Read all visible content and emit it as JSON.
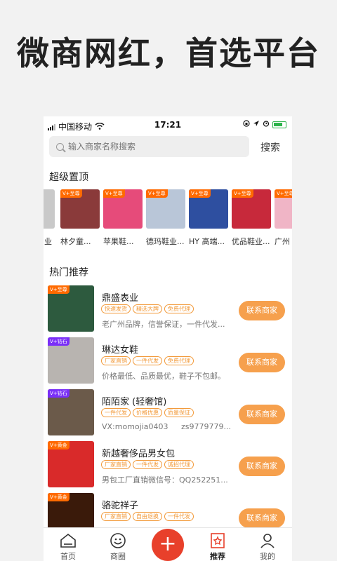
{
  "hero": {
    "title": "微商网红，首选平台"
  },
  "status_bar": {
    "carrier": "中国移动",
    "time": "17:21"
  },
  "search": {
    "placeholder": "输入商家名称搜索",
    "button": "搜索"
  },
  "sections": {
    "top": "超级置顶",
    "hot": "热门推荐"
  },
  "top_stores": [
    {
      "name": "业",
      "color": "#c9c9c9"
    },
    {
      "name": "林夕童...",
      "color": "#8a3a3a",
      "badge": "V+至尊"
    },
    {
      "name": "苹果鞋...",
      "color": "#e64b7a",
      "badge": "V+至尊"
    },
    {
      "name": "德玛鞋业...",
      "color": "#b9c6d8",
      "badge": "V+至尊"
    },
    {
      "name": "HY 高端...",
      "color": "#2e4fa0",
      "badge": "V+至尊"
    },
    {
      "name": "优品鞋业...",
      "color": "#c7293b",
      "badge": "V+至尊"
    },
    {
      "name": "广州",
      "color": "#f0b5c6",
      "badge": "V+至尊"
    }
  ],
  "hot_items": [
    {
      "title": "鼎盛表业",
      "tags": [
        "快速发货",
        "精选大牌",
        "免费代理"
      ],
      "desc": "老广州品牌，信誉保证，一件代发...",
      "desc2": "",
      "badge": "V+至尊",
      "color": "#2d5a3e",
      "button": "联系商家"
    },
    {
      "title": "琳达女鞋",
      "tags": [
        "厂家直销",
        "一件代发",
        "免费代理"
      ],
      "desc": "价格最低、品质最优，鞋子不包邮。",
      "desc2": "",
      "badge": "V+钻石",
      "color": "#b8b4b0",
      "button": "联系商家"
    },
    {
      "title": "陌陌家 (轻奢馆)",
      "tags": [
        "一件代发",
        "价格优惠",
        "质量保证"
      ],
      "desc": "VX:momojia0403",
      "desc2": "zs9779779...",
      "badge": "V+钻石",
      "color": "#6b5a4a",
      "button": "联系商家"
    },
    {
      "title": "新越奢侈品男女包",
      "tags": [
        "厂家直销",
        "一件代发",
        "诚招代理"
      ],
      "desc": "男包工厂直销微信号：QQ252251...",
      "desc2": "",
      "badge": "V+黄金",
      "color": "#d92a2a",
      "button": "联系商家"
    },
    {
      "title": "骆驼祥子",
      "tags": [
        "厂家直销",
        "自由退换",
        "一件代发"
      ],
      "desc": "",
      "desc2": "",
      "badge": "V+黄金",
      "color": "#3a1a0a",
      "button": "联系商家"
    }
  ],
  "tabs": [
    {
      "label": "首页"
    },
    {
      "label": "商圈"
    },
    {
      "label": "推荐"
    },
    {
      "label": "我的"
    }
  ],
  "fab": {
    "symbol": "+"
  },
  "colors": {
    "accent": "#f6a04d",
    "fab": "#e8402b",
    "tag": "#f29a3a"
  }
}
